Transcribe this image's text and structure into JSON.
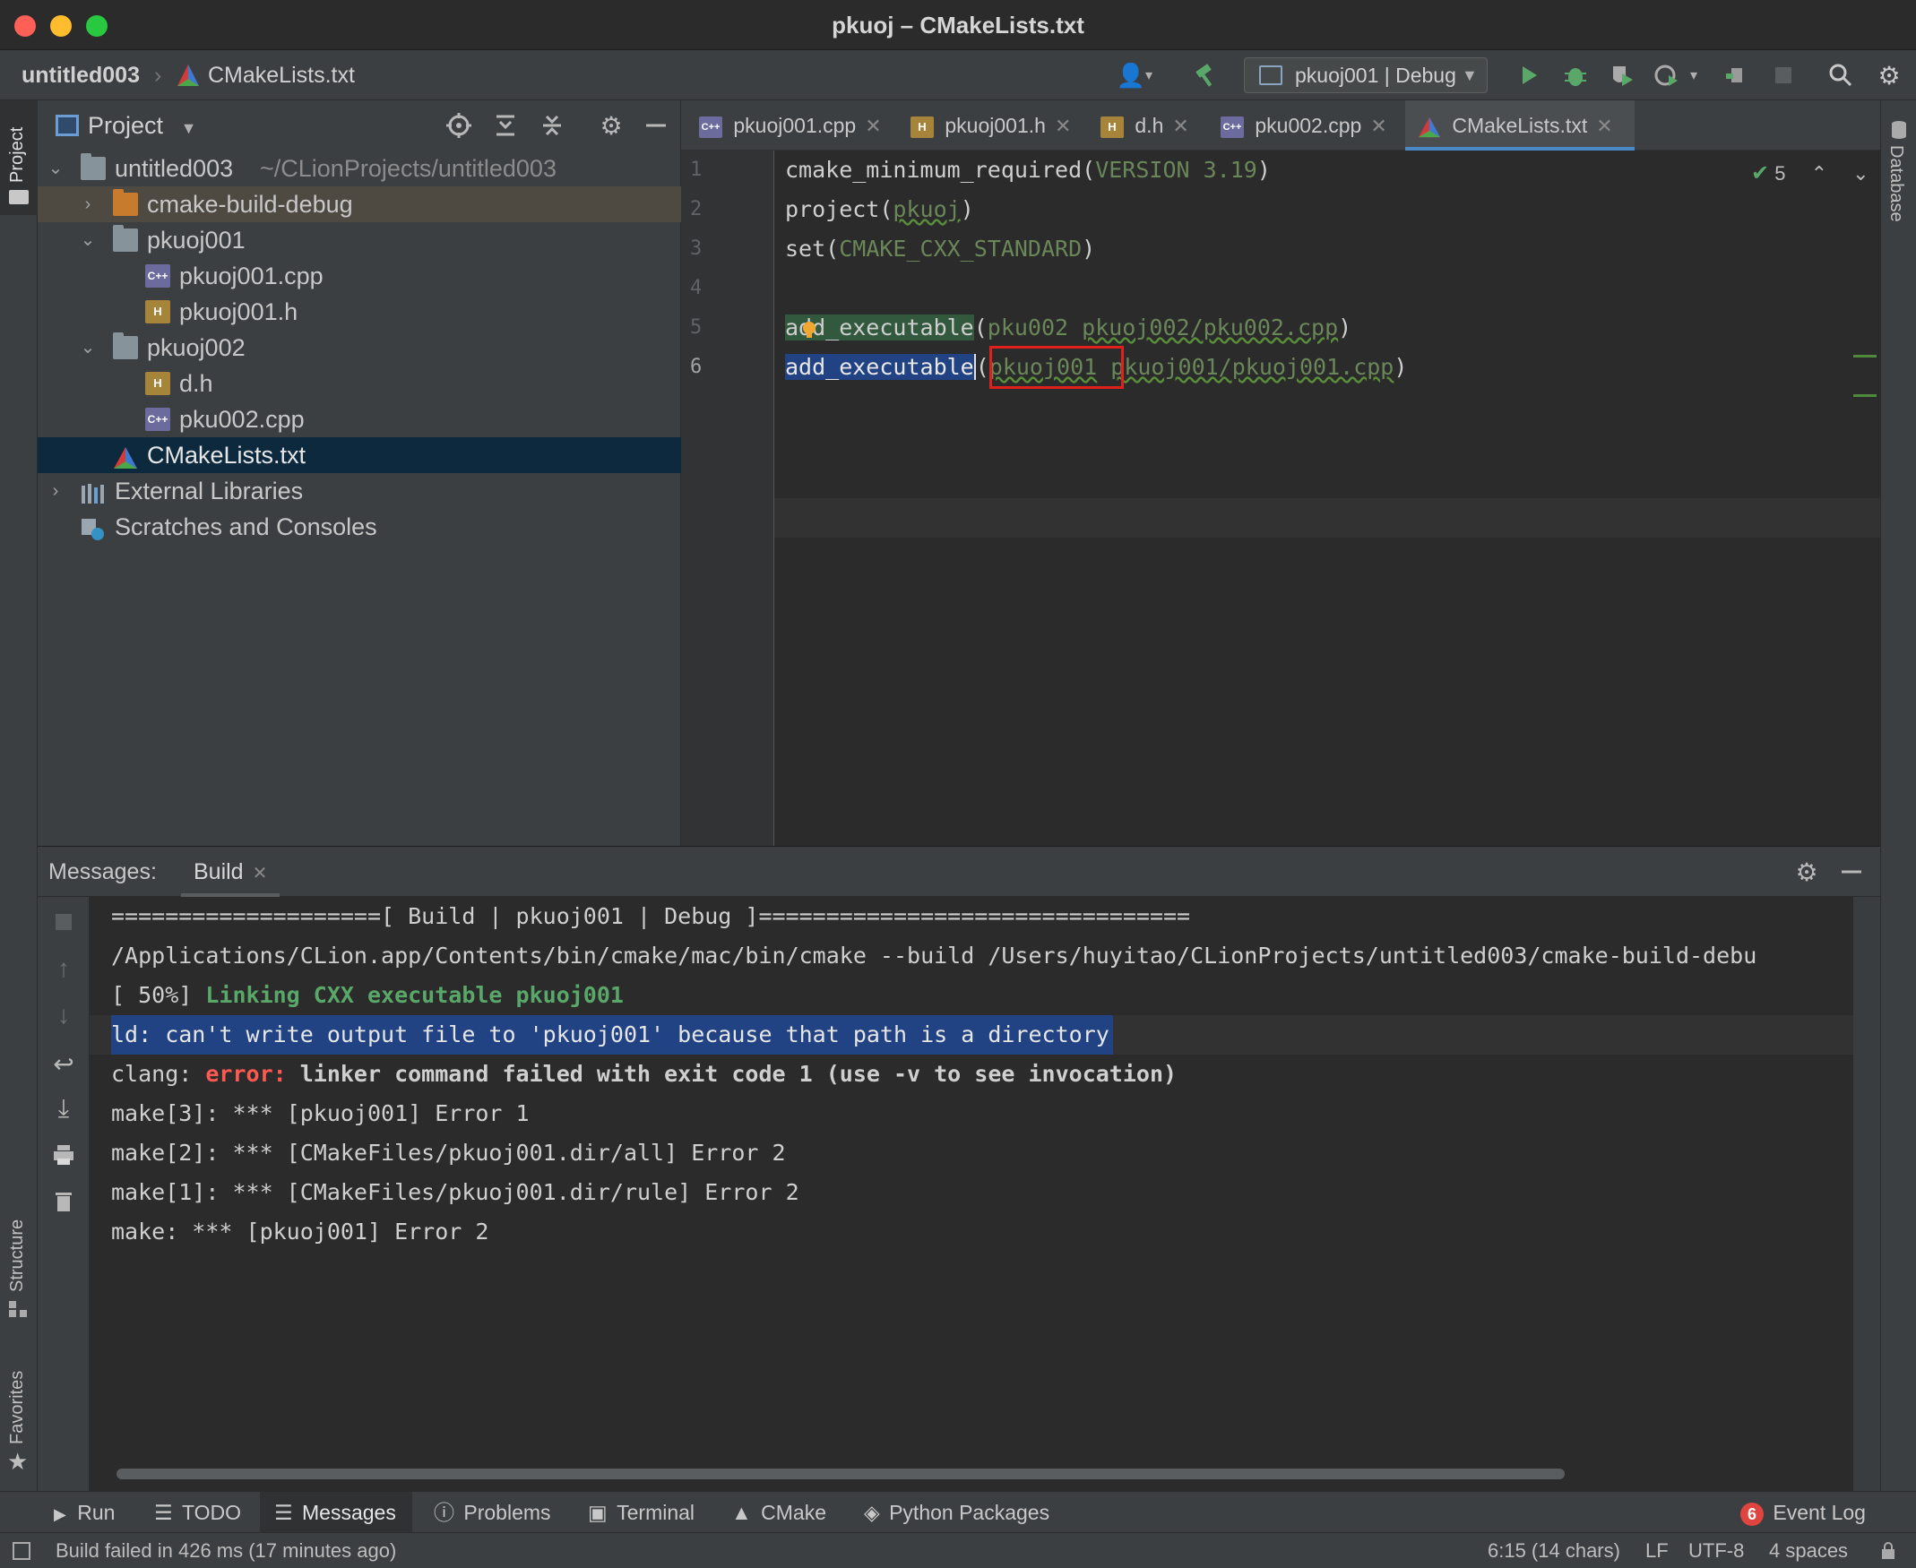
{
  "window": {
    "title": "pkuoj – CMakeLists.txt"
  },
  "navbar": {
    "breadcrumb_project": "untitled003",
    "breadcrumb_file": "CMakeLists.txt",
    "run_config": "pkuoj001 | Debug"
  },
  "left_strip": {
    "project_label": "Project",
    "structure_label": "Structure",
    "favorites_label": "Favorites"
  },
  "right_strip": {
    "database_label": "Database"
  },
  "project": {
    "header_label": "Project",
    "root_name": "untitled003",
    "root_path": "~/CLionProjects/untitled003",
    "items": [
      {
        "label": "cmake-build-debug"
      },
      {
        "label": "pkuoj001"
      },
      {
        "label": "pkuoj001.cpp"
      },
      {
        "label": "pkuoj001.h"
      },
      {
        "label": "pkuoj002"
      },
      {
        "label": "d.h"
      },
      {
        "label": "pku002.cpp"
      },
      {
        "label": "CMakeLists.txt"
      },
      {
        "label": "External Libraries"
      },
      {
        "label": "Scratches and Consoles"
      }
    ]
  },
  "editor": {
    "tabs": [
      {
        "label": "pkuoj001.cpp"
      },
      {
        "label": "pkuoj001.h"
      },
      {
        "label": "d.h"
      },
      {
        "label": "pku002.cpp"
      },
      {
        "label": "CMakeLists.txt"
      }
    ],
    "inspection_count": "5",
    "line_numbers": [
      "1",
      "2",
      "3",
      "4",
      "5",
      "6"
    ],
    "lines": {
      "l1_fn": "cmake_minimum_required(",
      "l1_arg": "VERSION 3.19",
      "l1_close": ")",
      "l2_fn": "project(",
      "l2_arg": "pkuoj",
      "l2_close": ")",
      "l3_fn": "set(",
      "l3_arg": "CMAKE_CXX_STANDARD",
      "l3_close": ")",
      "l5_fn": "add_executable",
      "l5_open": "(",
      "l5_a1": "pku002",
      "l5_a2": "pkuoj002/pku002.cpp",
      "l5_close": ")",
      "l6_fn": "add_executable",
      "l6_open": "(",
      "l6_a1": "pkuoj001",
      "l6_a2": "pkuoj001/pkuoj001.cpp",
      "l6_close": ")"
    }
  },
  "messages": {
    "label": "Messages:",
    "tab": "Build",
    "output": {
      "o1": "====================[ Build | pkuoj001 | Debug ]================================",
      "o2": "/Applications/CLion.app/Contents/bin/cmake/mac/bin/cmake --build /Users/huyitao/CLionProjects/untitled003/cmake-build-debu",
      "o3_prefix": "[ 50%] ",
      "o3_green": "Linking CXX executable pkuoj001",
      "o4": "ld: can't write output file to 'pkuoj001' because that path is a directory",
      "o5_prefix": "clang: ",
      "o5_error": "error:",
      "o5_rest": " linker command failed with exit code 1 (use -v to see invocation)",
      "o6": "make[3]: *** [pkuoj001] Error 1",
      "o7": "make[2]: *** [CMakeFiles/pkuoj001.dir/all] Error 2",
      "o8": "make[1]: *** [CMakeFiles/pkuoj001.dir/rule] Error 2",
      "o9": "make: *** [pkuoj001] Error 2"
    }
  },
  "bottom_tabs": {
    "run": "Run",
    "todo": "TODO",
    "messages": "Messages",
    "problems": "Problems",
    "terminal": "Terminal",
    "cmake": "CMake",
    "python_packages": "Python Packages",
    "event_log_count": "6",
    "event_log": "Event Log"
  },
  "status": {
    "message": "Build failed in 426 ms (17 minutes ago)",
    "position": "6:15 (14 chars)",
    "line_sep": "LF",
    "encoding": "UTF-8",
    "indent": "4 spaces"
  },
  "colors": {
    "accent_blue": "#4a88c7",
    "selection": "#214283",
    "run_green": "#59a869",
    "error_red": "#ff5a52",
    "annotation_box": "#e0201b"
  }
}
